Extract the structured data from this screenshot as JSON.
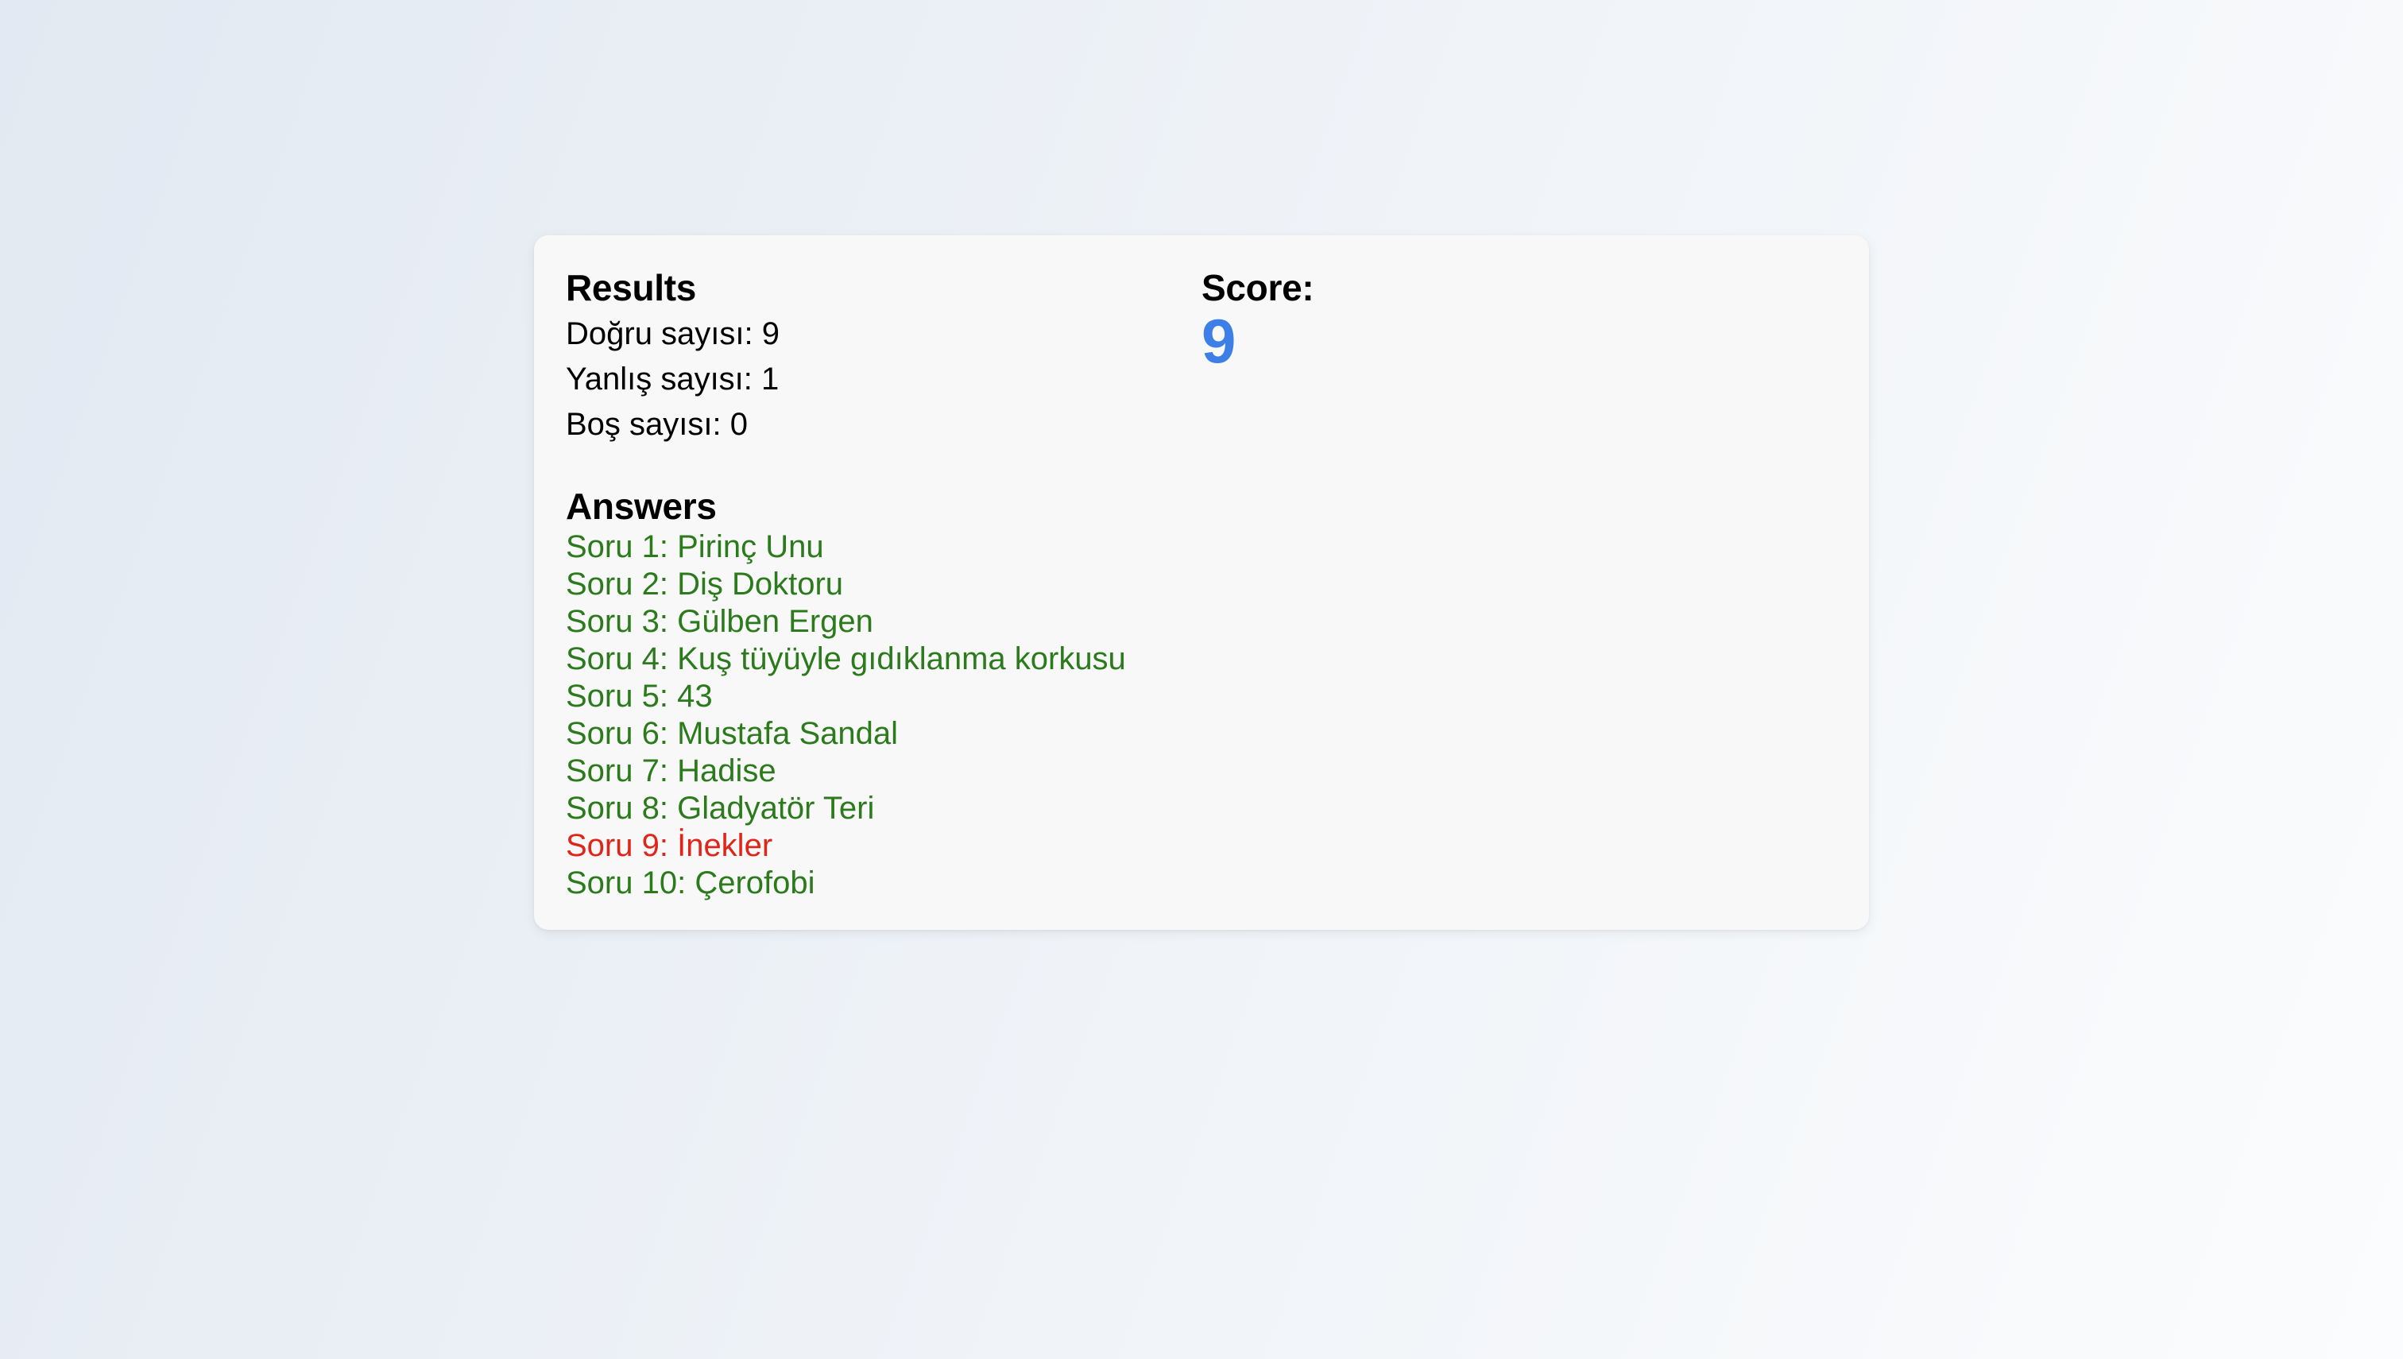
{
  "colors": {
    "correct": "#2b7a1c",
    "wrong": "#e02418",
    "score": "#3d7fe6"
  },
  "results": {
    "title": "Results",
    "stats": [
      {
        "text": "Doğru sayısı: 9"
      },
      {
        "text": "Yanlış sayısı: 1"
      },
      {
        "text": "Boş sayısı: 0"
      }
    ]
  },
  "answers": {
    "title": "Answers",
    "items": [
      {
        "text": "Soru 1: Pirinç Unu",
        "status": "correct"
      },
      {
        "text": "Soru 2: Diş Doktoru",
        "status": "correct"
      },
      {
        "text": "Soru 3: Gülben Ergen",
        "status": "correct"
      },
      {
        "text": "Soru 4: Kuş tüyüyle gıdıklanma korkusu",
        "status": "correct"
      },
      {
        "text": "Soru 5: 43",
        "status": "correct"
      },
      {
        "text": "Soru 6: Mustafa Sandal",
        "status": "correct"
      },
      {
        "text": "Soru 7: Hadise",
        "status": "correct"
      },
      {
        "text": "Soru 8: Gladyatör Teri",
        "status": "correct"
      },
      {
        "text": "Soru 9: İnekler",
        "status": "wrong"
      },
      {
        "text": "Soru 10: Çerofobi",
        "status": "correct"
      }
    ]
  },
  "score": {
    "label": "Score:",
    "value": "9"
  }
}
